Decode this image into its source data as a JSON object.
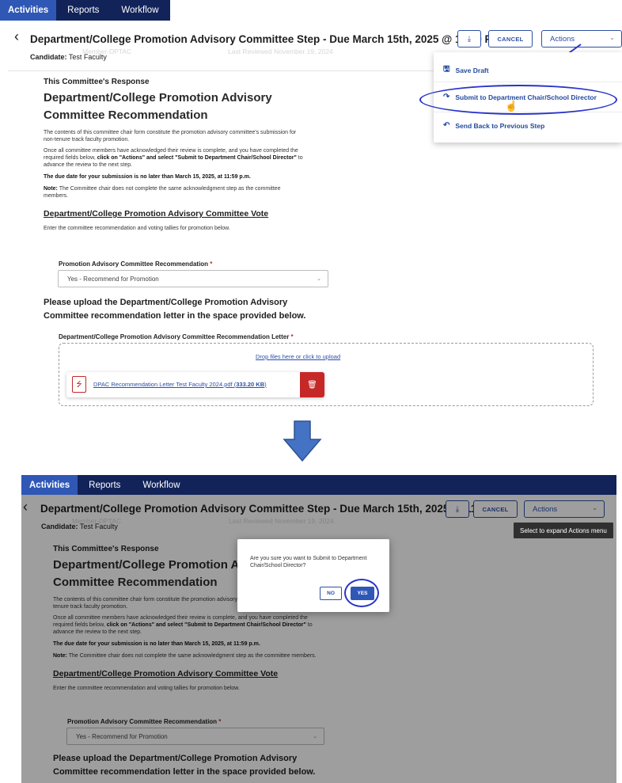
{
  "nav": {
    "items": [
      "Activities",
      "Reports",
      "Workflow"
    ]
  },
  "header": {
    "back_icon": "chevron-left",
    "title": "Department/College Promotion Advisory Committee Step - Due March 15th, 2025 @ 11:59 PM",
    "candidate_label": "Candidate:",
    "candidate_name": "Test Faculty",
    "ghost_member": "Member-DPTAC",
    "ghost_reviewed": "Last Reviewed November 19, 2024",
    "download_icon": "download-icon",
    "cancel_label": "CANCEL",
    "actions_label": "Actions"
  },
  "actions_menu": {
    "items": [
      {
        "label": "Save Draft",
        "icon": "save-icon"
      },
      {
        "label": "Submit to Department Chair/School Director",
        "icon": "share-forward-icon"
      },
      {
        "label": "Send Back to Previous Step",
        "icon": "undo-icon"
      }
    ]
  },
  "form": {
    "section_label": "This Committee's Response",
    "heading_line1": "Department/College Promotion Advisory",
    "heading_line2": "Committee Recommendation",
    "para1": "The contents of this committee chair form constitute the promotion advisory committee's submission for non-tenure track faculty promotion.",
    "para2_a": "Once all committee members have acknowledged their review is complete, and you have completed the required fields below, ",
    "para2_b": "click on \"Actions\" and select \"Submit to Department Chair/School Director\"",
    "para2_c": " to advance the review to the next step.",
    "due_note": "The due date for your submission is no later than March 15, 2025, at 11:59 p.m.",
    "note_label": "Note:",
    "note_text": " The Committee chair does not complete the same acknowledgment step as the committee members.",
    "vote_heading": "Department/College Promotion Advisory Committee Vote",
    "vote_intro": "Enter the committee recommendation and voting tallies for promotion below.",
    "rec_label": "Promotion Advisory Committee Recommendation",
    "rec_value": "Yes - Recommend for Promotion",
    "upload_heading_line1": "Please upload the Department/College Promotion Advisory",
    "upload_heading_line2": "Committee recommendation letter in the space provided below.",
    "letter_label": "Department/College Promotion Advisory Committee Recommendation Letter",
    "required_mark": "*",
    "drop_text": "Drop files here or click to upload",
    "file_name": "DPAC Recommendation Letter Test Faculty 2024.pdf",
    "file_size": "333.20 KB"
  },
  "confirm_dialog": {
    "message": "Are you sure you want to Submit to Department Chair/School Director?",
    "no_label": "NO",
    "yes_label": "YES"
  },
  "tooltip": "Select to expand Actions menu",
  "colors": {
    "nav_bg": "#12235a",
    "nav_active": "#2f57b6",
    "accent": "#2d4fa8",
    "annotation": "#2933c9",
    "danger": "#c62828",
    "arrow": "#4472c4"
  }
}
